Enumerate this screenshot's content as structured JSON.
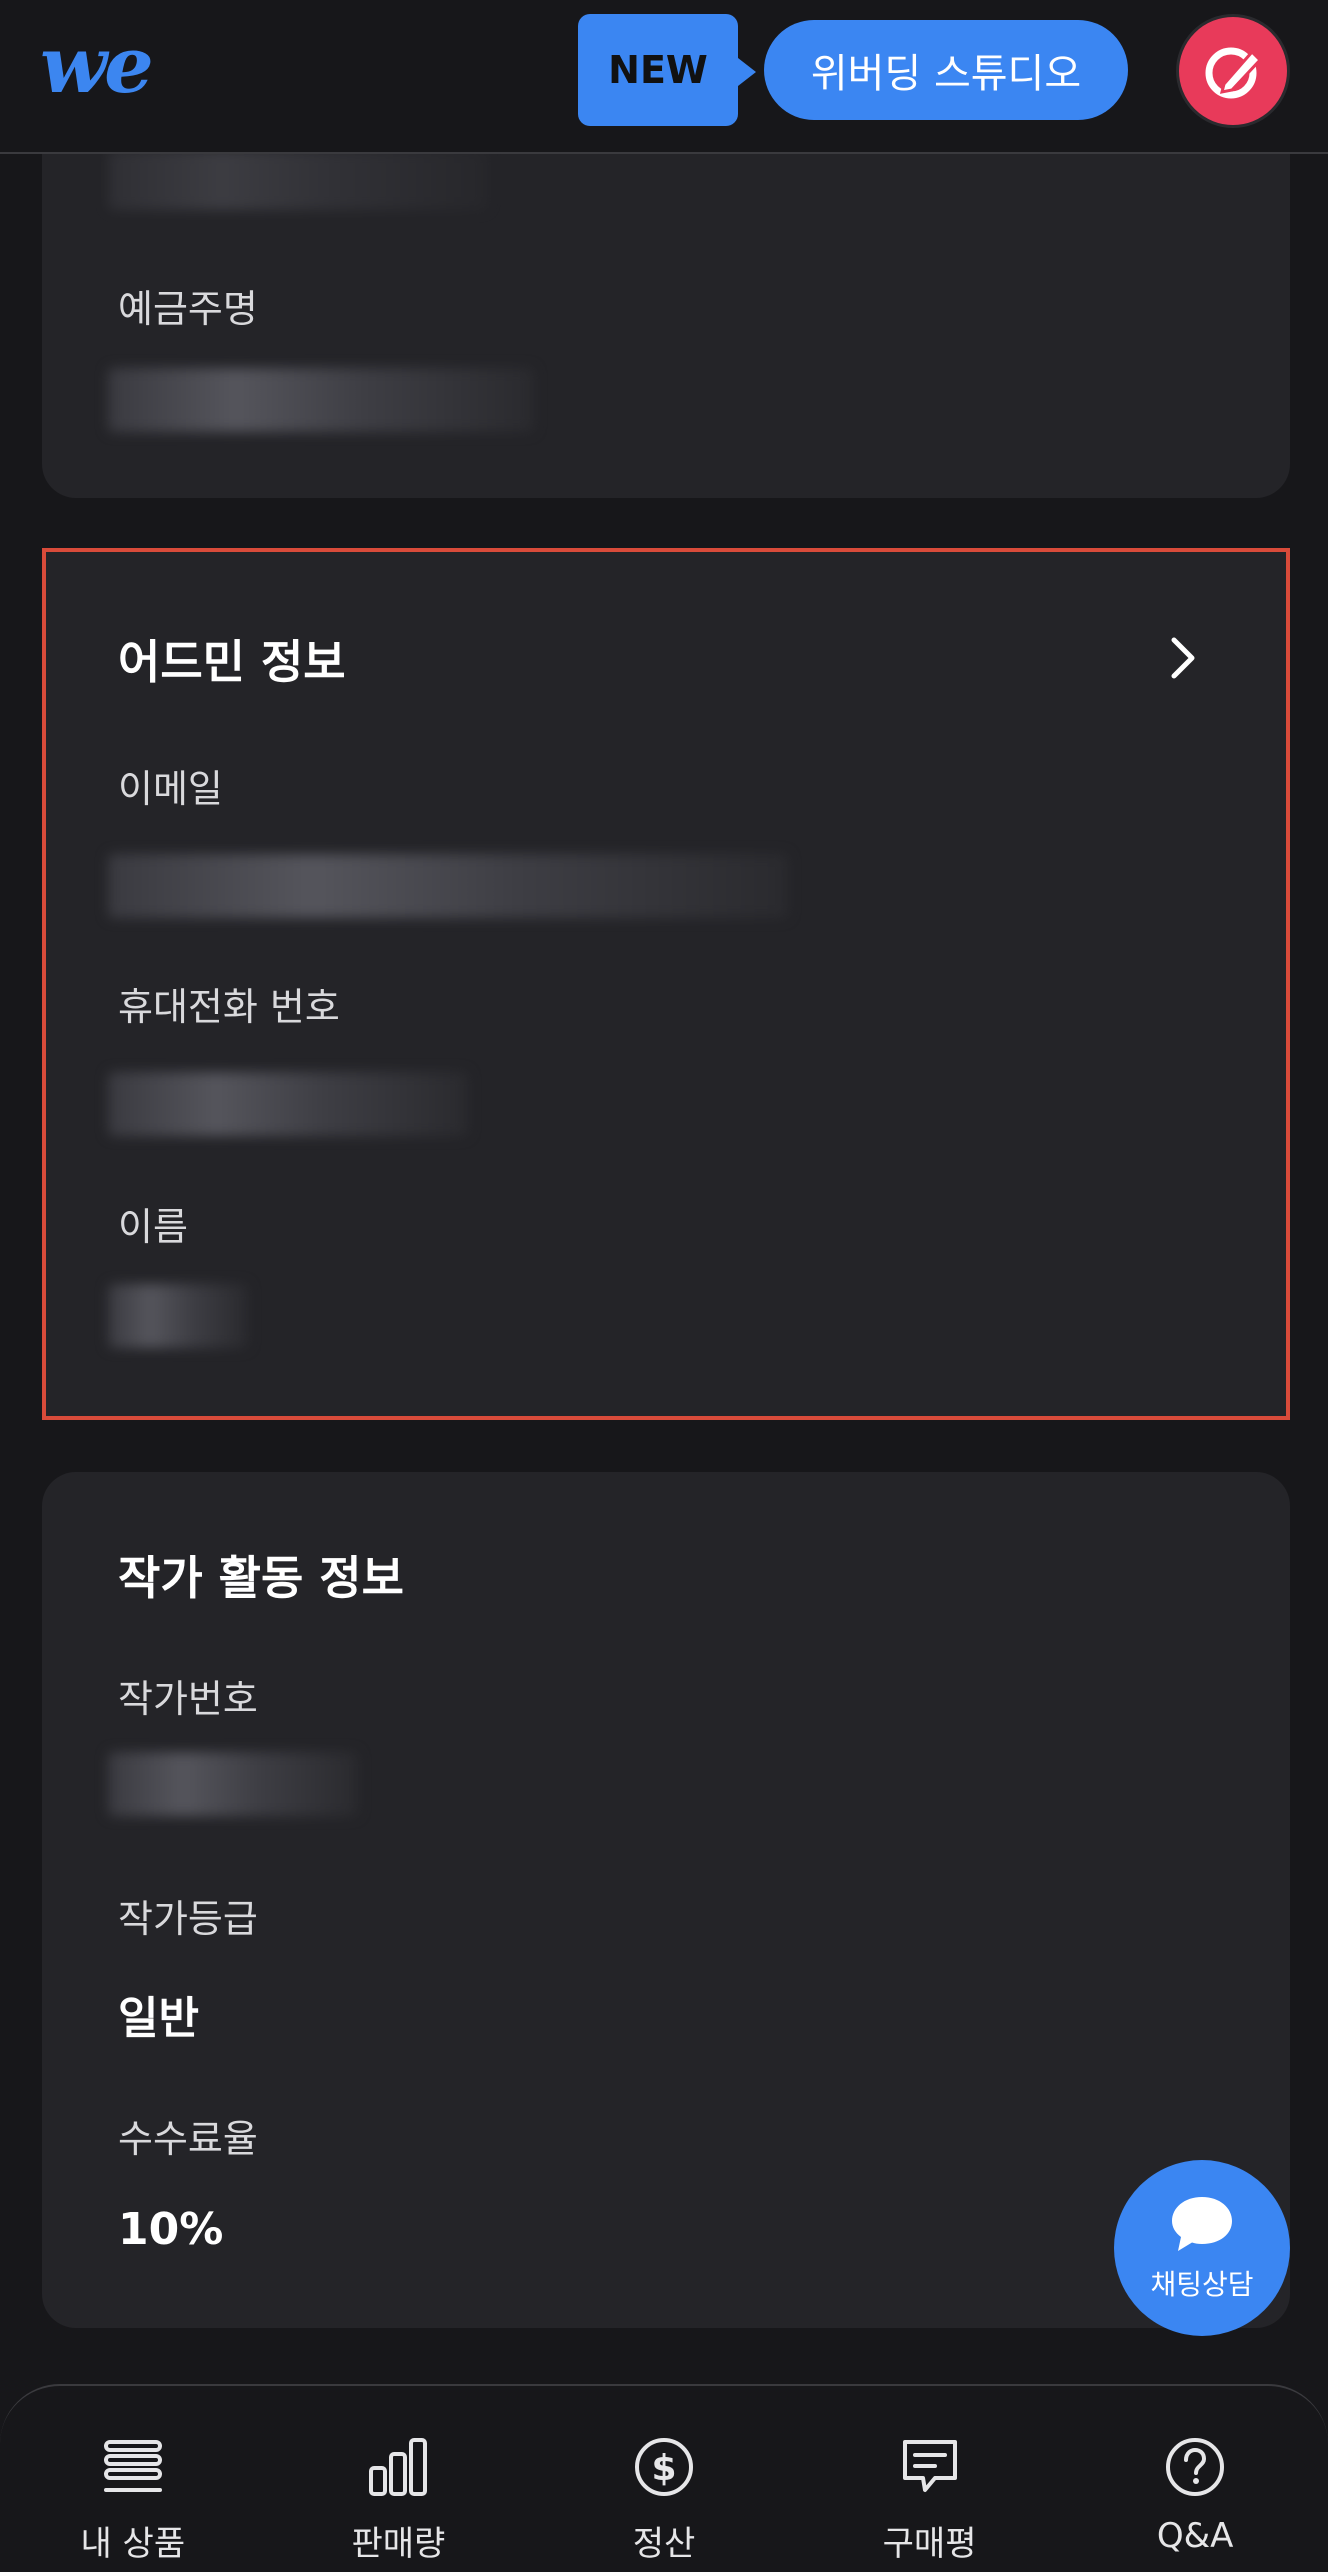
{
  "header": {
    "logo_text": "we",
    "new_badge": "NEW",
    "studio_button": "위버딩 스튜디오",
    "avatar_icon": "edit-pencil-icon",
    "accent_color": "#3b86f2",
    "avatar_color": "#e83a5a"
  },
  "account_card": {
    "holder_label": "예금주명"
  },
  "admin_card": {
    "title": "어드민 정보",
    "email_label": "이메일",
    "phone_label": "휴대전화 번호",
    "name_label": "이름",
    "highlight_color": "#d94b3a"
  },
  "author_card": {
    "title": "작가 활동 정보",
    "number_label": "작가번호",
    "grade_label": "작가등급",
    "grade_value": "일반",
    "fee_label": "수수료율",
    "fee_value": "10%"
  },
  "chat": {
    "label": "채팅상담",
    "icon": "chat-bubble-icon"
  },
  "bottom_nav": {
    "items": [
      {
        "label": "내 상품",
        "icon": "list-icon"
      },
      {
        "label": "판매량",
        "icon": "bar-chart-icon"
      },
      {
        "label": "정산",
        "icon": "dollar-circle-icon"
      },
      {
        "label": "구매평",
        "icon": "comment-icon"
      },
      {
        "label": "Q&A",
        "icon": "question-circle-icon"
      }
    ]
  }
}
